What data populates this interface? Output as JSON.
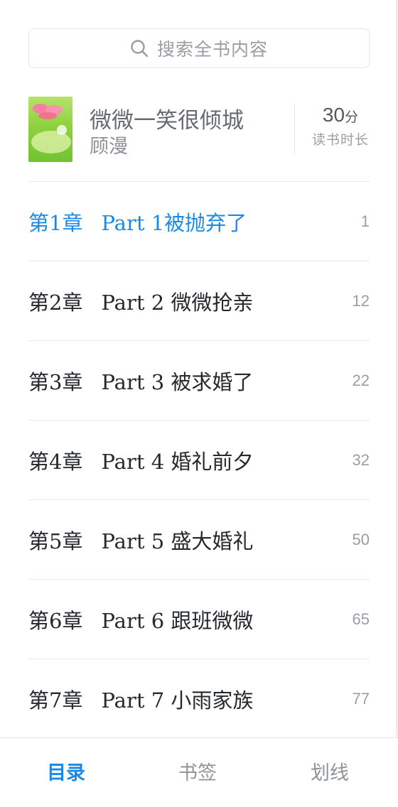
{
  "search": {
    "placeholder": "搜索全书内容",
    "icon": "search-icon"
  },
  "book": {
    "title": "微微一笑很倾城",
    "author": "顾漫",
    "reading_time_value": "30",
    "reading_time_unit": "分",
    "reading_time_label": "读书时长"
  },
  "chapters": [
    {
      "number": "第1章",
      "title": "Part 1被抛弃了",
      "page": "1",
      "active": true
    },
    {
      "number": "第2章",
      "title": "Part 2 微微抢亲",
      "page": "12",
      "active": false
    },
    {
      "number": "第3章",
      "title": "Part 3 被求婚了",
      "page": "22",
      "active": false
    },
    {
      "number": "第4章",
      "title": "Part 4 婚礼前夕",
      "page": "32",
      "active": false
    },
    {
      "number": "第5章",
      "title": "Part 5 盛大婚礼",
      "page": "50",
      "active": false
    },
    {
      "number": "第6章",
      "title": "Part 6 跟班微微",
      "page": "65",
      "active": false
    },
    {
      "number": "第7章",
      "title": "Part 7 小雨家族",
      "page": "77",
      "active": false
    }
  ],
  "tabs": [
    {
      "label": "目录",
      "active": true
    },
    {
      "label": "书签",
      "active": false
    },
    {
      "label": "划线",
      "active": false
    }
  ],
  "colors": {
    "accent": "#1a8ae6",
    "text": "#25282c",
    "muted": "#9a9ea4",
    "divider": "#e6e8eb"
  }
}
